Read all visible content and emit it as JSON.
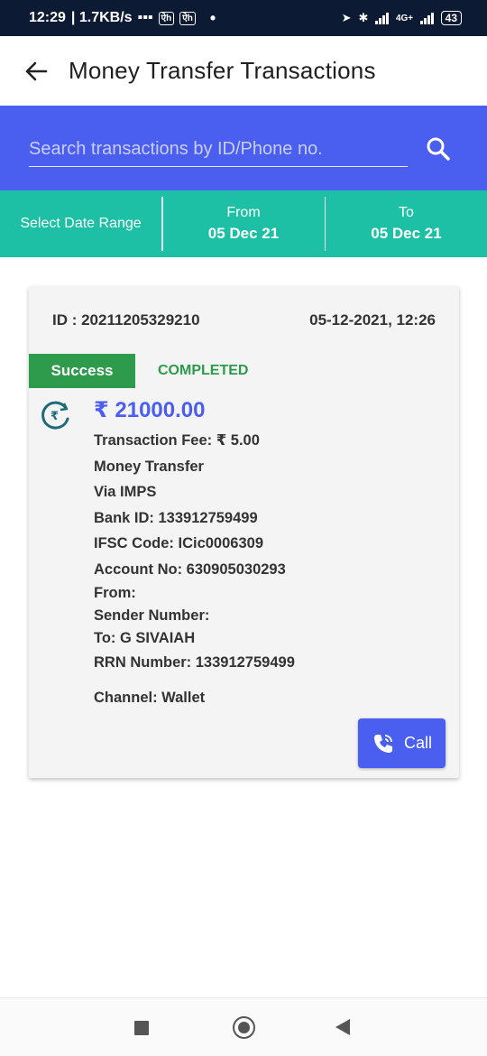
{
  "status_bar": {
    "time": "12:29",
    "speed": "| 1.7KB/s",
    "battery": "43",
    "network": "4G+"
  },
  "app_bar": {
    "title": "Money Transfer Transactions"
  },
  "search": {
    "placeholder": "Search transactions by ID/Phone no."
  },
  "date_range": {
    "label": "Select Date Range",
    "from_label": "From",
    "from_value": "05 Dec 21",
    "to_label": "To",
    "to_value": "05 Dec 21"
  },
  "transaction": {
    "id": "ID : 20211205329210",
    "datetime": "05-12-2021, 12:26",
    "badge": "Success",
    "state": "COMPLETED",
    "amount": "₹ 21000.00",
    "fee": "Transaction Fee: ₹ 5.00",
    "type": "Money Transfer",
    "via": "Via  IMPS",
    "bank_id": "Bank ID:  133912759499",
    "ifsc": "IFSC Code:  ICic0006309",
    "account": "Account No: 630905030293",
    "from": "From:",
    "sender": "Sender Number:",
    "to": "To:  G SIVAIAH",
    "rrn": "RRN Number:  133912759499",
    "channel": "Channel:  Wallet",
    "call_label": "Call"
  },
  "colors": {
    "primary": "#4a5ef0",
    "teal": "#1dbfa5",
    "success": "#2d9a4c",
    "status_bar": "#0c1a33"
  }
}
